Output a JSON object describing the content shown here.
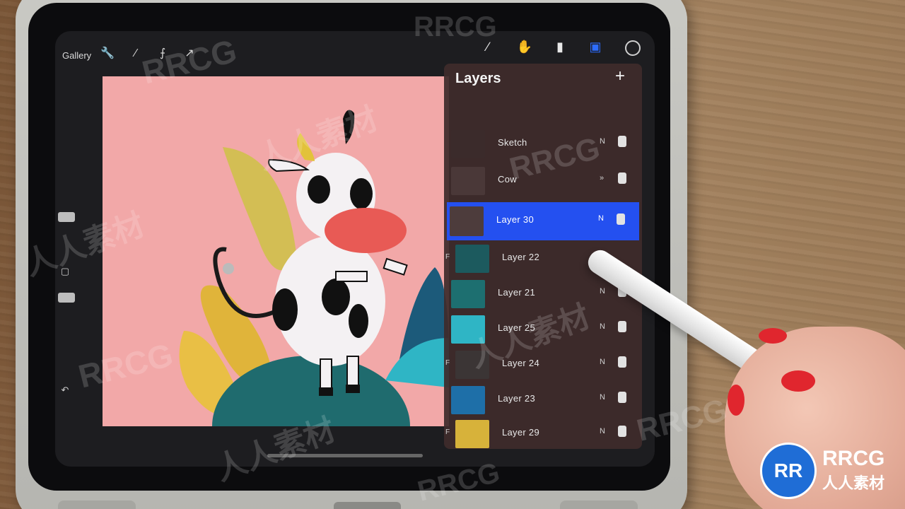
{
  "toolbar": {
    "gallery_label": "Gallery",
    "icons": [
      "wrench-icon",
      "magic-wand-icon",
      "selection-icon",
      "transform-arrow-icon"
    ],
    "tools": [
      "brush-icon",
      "smudge-icon",
      "eraser-icon",
      "layers-icon",
      "color-picker-icon"
    ]
  },
  "sidebar": {
    "icons": [
      "brush-size-slider",
      "modify-button-icon",
      "opacity-slider",
      "undo-icon"
    ]
  },
  "layers": {
    "title": "Layers",
    "add_label": "+",
    "items": [
      {
        "name": "Sketch",
        "mode": "N",
        "visible": true
      },
      {
        "name": "Cow",
        "mode": "»",
        "visible": true
      },
      {
        "name": "Layer 30",
        "mode": "N",
        "visible": true,
        "selected": true
      },
      {
        "name": "Layer 22",
        "mode": "",
        "visible": true,
        "clip": "F"
      },
      {
        "name": "Layer 21",
        "mode": "N",
        "visible": true
      },
      {
        "name": "Layer 25",
        "mode": "N",
        "visible": true
      },
      {
        "name": "Layer 24",
        "mode": "N",
        "visible": true,
        "clip": "F"
      },
      {
        "name": "Layer 23",
        "mode": "N",
        "visible": true
      },
      {
        "name": "Layer 29",
        "mode": "N",
        "visible": true,
        "clip": "F"
      }
    ]
  },
  "colors": {
    "canvas_bg": "#f2a8a8",
    "selected_layer": "#2450f0",
    "accent": "#2d6cff"
  },
  "watermark": {
    "text": "RRCG",
    "cn_text": "人人素材"
  }
}
